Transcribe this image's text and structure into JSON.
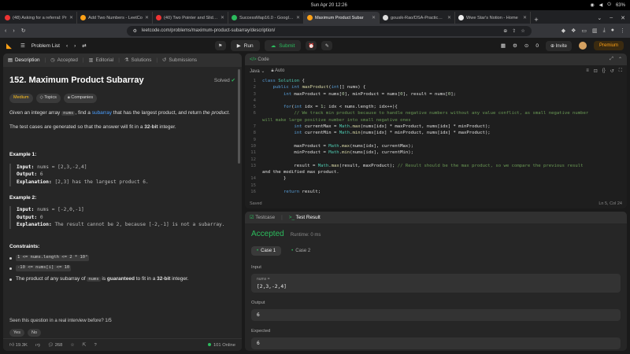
{
  "os": {
    "datetime": "Sun Apr 20  12:26",
    "battery": "63%"
  },
  "browser": {
    "tabs": [
      {
        "label": "(48) Asking for a referral: Pr",
        "color": "#e33",
        "active": false
      },
      {
        "label": "Add Two Numbers - LeetCo",
        "color": "#ffa116",
        "active": false
      },
      {
        "label": "(40) Two Pointer and Sliding",
        "color": "#e33",
        "active": false
      },
      {
        "label": "SuccessMap16.0 - Google Sh",
        "color": "#2cbb5d",
        "active": false
      },
      {
        "label": "Maximum Product Subar",
        "color": "#ffa116",
        "active": true
      },
      {
        "label": "gousik-Rao/DSA-Practice at",
        "color": "#ddd",
        "active": false
      },
      {
        "label": "Wwe Star's Notion - Home",
        "color": "#eee",
        "active": false
      }
    ],
    "url": "leetcode.com/problems/maximum-product-subarray/description/"
  },
  "nav": {
    "problem_list": "Problem List",
    "run": "Run",
    "submit": "Submit",
    "streak": "0",
    "invite": "Invite",
    "premium": "Premium"
  },
  "left_tabs": [
    "Description",
    "Accepted",
    "Editorial",
    "Solutions",
    "Submissions"
  ],
  "problem": {
    "title": "152. Maximum Product Subarray",
    "solved": "Solved",
    "difficulty": "Medium",
    "topics": "Topics",
    "companies": "Companies",
    "p1_a": "Given an integer array ",
    "p1_code": "nums",
    "p1_b": ", find a ",
    "p1_link": "subarray",
    "p1_c": " that has the largest product, and return ",
    "p1_em": "the product",
    "p1_d": ".",
    "p2_a": "The test cases are generated so that the answer will fit in a ",
    "p2_b": "32-bit",
    "p2_c": " integer.",
    "ex1_head": "Example 1:",
    "ex1_input": "nums = [2,3,-2,4]",
    "ex1_output": "6",
    "ex1_expl": "[2,3] has the largest product 6.",
    "ex2_head": "Example 2:",
    "ex2_input": "nums = [-2,0,-1]",
    "ex2_output": "0",
    "ex2_expl": "The result cannot be 2, because [-2,-1] is not a subarray.",
    "lbl_input": "Input:",
    "lbl_output": "Output:",
    "lbl_expl": "Explanation:",
    "constraints_head": "Constraints:",
    "c1": "1 <= nums.length <= 2 * 10⁴",
    "c2": "-10 <= nums[i] <= 10",
    "c3_a": "The product of any subarray of ",
    "c3_code": "nums",
    "c3_b": " is ",
    "c3_bold1": "guaranteed",
    "c3_c": " to fit in a ",
    "c3_bold2": "32-bit",
    "c3_d": " integer.",
    "seen": "Seen this question in a real interview before?    1/5",
    "yes": "Yes",
    "no": "No"
  },
  "footer": {
    "likes": "19.3K",
    "comments": "268",
    "online": "101 Online"
  },
  "code_panel": {
    "title": "Code",
    "lang": "Java",
    "mode": "Auto",
    "saved": "Saved",
    "cursor": "Ln 5, Col 24",
    "lines": [
      {
        "n": "1",
        "t": "class Solution {"
      },
      {
        "n": "2",
        "t": "    public int maxProduct(int[] nums) {"
      },
      {
        "n": "3",
        "t": "        int maxProduct = nums[0], minProduct = nums[0], result = nums[0];"
      },
      {
        "n": "4",
        "t": ""
      },
      {
        "n": "5",
        "t": "        for(int idx = 1; idx < nums.length; idx++){"
      },
      {
        "n": "6",
        "t": "            // We track min product because to handle negative numbers without any value conflict, as small negative number"
      },
      {
        "n": "",
        "t": "will make large positive number into small negative ones"
      },
      {
        "n": "7",
        "t": "            int currentMax = Math.max(nums[idx] * maxProduct, nums[idx] * minProduct);"
      },
      {
        "n": "8",
        "t": "            int currentMin = Math.min(nums[idx] * minProduct, nums[idx] * maxProduct);"
      },
      {
        "n": "9",
        "t": ""
      },
      {
        "n": "10",
        "t": "            maxProduct = Math.max(nums[idx], currentMax);"
      },
      {
        "n": "11",
        "t": "            minProduct = Math.min(nums[idx], currentMin);"
      },
      {
        "n": "12",
        "t": ""
      },
      {
        "n": "13",
        "t": "            result = Math.max(result, maxProduct); // Result should be the max product, so we compare the previous result"
      },
      {
        "n": "",
        "t": "and the modified max product."
      },
      {
        "n": "14",
        "t": "        }"
      },
      {
        "n": "15",
        "t": ""
      },
      {
        "n": "16",
        "t": "        return result;"
      }
    ]
  },
  "result": {
    "tab_testcase": "Testcase",
    "tab_result": "Test Result",
    "status": "Accepted",
    "runtime": "Runtime: 0 ms",
    "case1": "Case 1",
    "case2": "Case 2",
    "input_label": "Input",
    "input_var": "nums =",
    "input_val": "[2,3,-2,4]",
    "output_label": "Output",
    "output_val": "6",
    "expected_label": "Expected",
    "expected_val": "6"
  }
}
